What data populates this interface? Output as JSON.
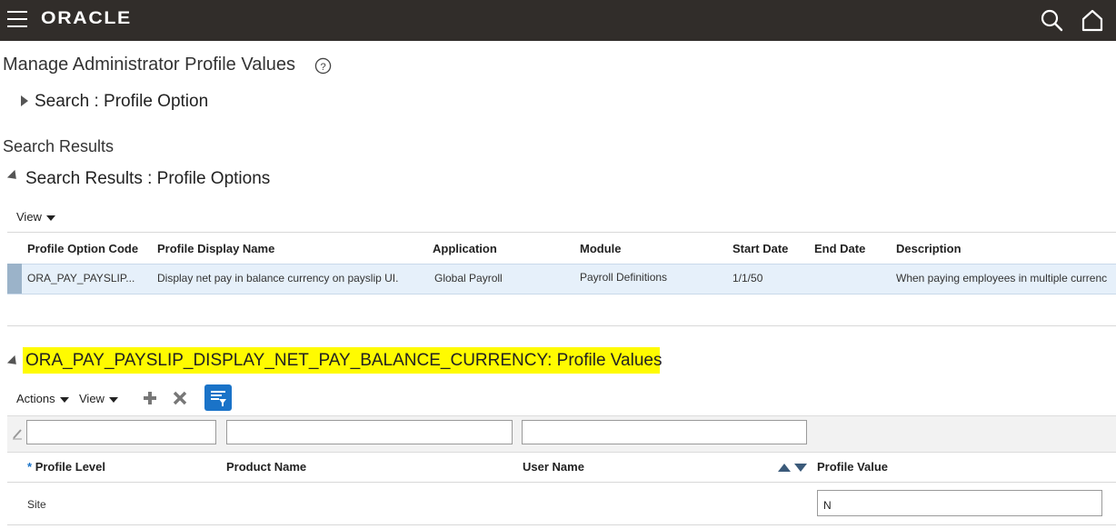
{
  "header": {
    "brand": "ORACLE"
  },
  "page": {
    "title": "Manage Administrator Profile Values",
    "search_section": "Search : Profile Option",
    "results_heading": "Search Results",
    "results_section": "Search Results : Profile Options"
  },
  "results_toolbar": {
    "view_label": "View"
  },
  "results_table": {
    "columns": [
      "Profile Option Code",
      "Profile Display Name",
      "Application",
      "Module",
      "Start Date",
      "End Date",
      "Description"
    ],
    "rows": [
      [
        "ORA_PAY_PAYSLIP...",
        "Display net pay in balance currency on payslip UI.",
        "Global Payroll",
        "Payroll Definitions",
        "1/1/50",
        "",
        "When paying employees in multiple currenc"
      ]
    ]
  },
  "values_section": {
    "title": "ORA_PAY_PAYSLIP_DISPLAY_NET_PAY_BALANCE_CURRENCY: Profile Values",
    "actions_label": "Actions",
    "view_label": "View",
    "required_marker": "*",
    "columns": [
      "Profile Level",
      "Product Name",
      "User Name",
      "Profile Value"
    ],
    "rows": [
      {
        "level": "Site",
        "product": "",
        "user": "",
        "value": "N"
      }
    ]
  },
  "colors": {
    "topbar": "#312d2a",
    "highlight": "#fffb00",
    "selected_row": "#e6f0fa",
    "accent": "#1a73c8"
  }
}
